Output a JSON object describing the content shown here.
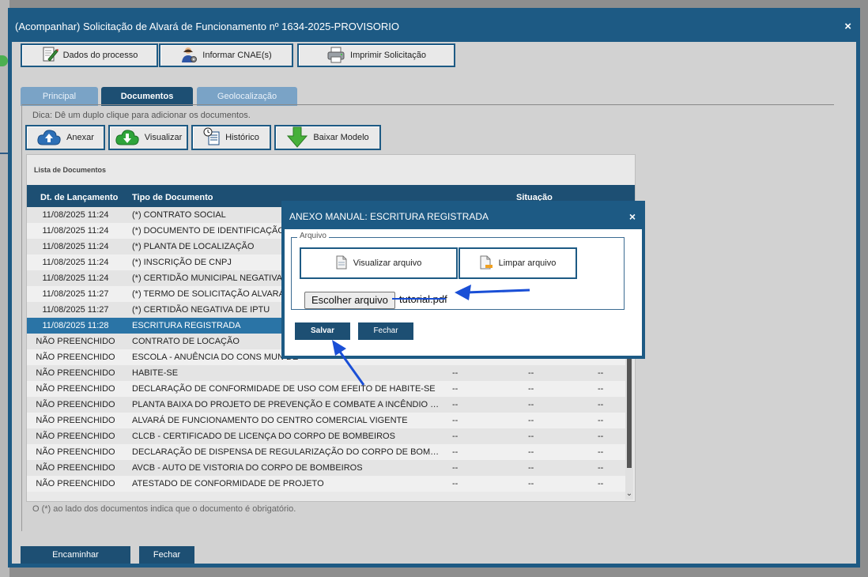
{
  "window": {
    "title": "(Acompanhar) Solicitação de Alvará de Funcionamento nº 1634-2025-PROVISORIO",
    "close": "×"
  },
  "toolbar": {
    "dados": "Dados do processo",
    "cnae": "Informar CNAE(s)",
    "imprimir": "Imprimir Solicitação"
  },
  "tabs": [
    {
      "label": "Principal"
    },
    {
      "label": "Documentos"
    },
    {
      "label": "Geolocalização"
    }
  ],
  "hint": "Dica: Dê um duplo clique para adicionar os documentos.",
  "docToolbar": {
    "anexar": "Anexar",
    "visualizar": "Visualizar",
    "historico": "Histórico",
    "baixar": "Baixar Modelo"
  },
  "list": {
    "title": "Lista de Documentos",
    "headers": {
      "date": "Dt. de Lançamento",
      "type": "Tipo de Documento",
      "status": "Situação"
    },
    "rows": [
      {
        "date": "11/08/2025 11:24",
        "type": "(*) CONTRATO SOCIAL",
        "a": "",
        "b": "",
        "c": ""
      },
      {
        "date": "11/08/2025 11:24",
        "type": "(*) DOCUMENTO DE IDENTIFICAÇÃO DO",
        "a": "",
        "b": "",
        "c": ""
      },
      {
        "date": "11/08/2025 11:24",
        "type": "(*) PLANTA DE LOCALIZAÇÃO",
        "a": "",
        "b": "",
        "c": ""
      },
      {
        "date": "11/08/2025 11:24",
        "type": "(*) INSCRIÇÃO DE CNPJ",
        "a": "",
        "b": "",
        "c": ""
      },
      {
        "date": "11/08/2025 11:24",
        "type": "(*) CERTIDÃO MUNICIPAL NEGATIVA DE",
        "a": "",
        "b": "",
        "c": ""
      },
      {
        "date": "11/08/2025 11:27",
        "type": "(*) TERMO DE SOLICITAÇÃO ALVARÁ DE",
        "a": "",
        "b": "",
        "c": ""
      },
      {
        "date": "11/08/2025 11:27",
        "type": "(*) CERTIDÃO NEGATIVA DE IPTU",
        "a": "",
        "b": "",
        "c": ""
      },
      {
        "date": "11/08/2025 11:28",
        "type": "ESCRITURA REGISTRADA",
        "a": "",
        "b": "",
        "c": ""
      },
      {
        "date": "NÃO PREENCHIDO",
        "type": "CONTRATO DE LOCAÇÃO",
        "a": "",
        "b": "",
        "c": ""
      },
      {
        "date": "NÃO PREENCHIDO",
        "type": "ESCOLA - ANUÊNCIA DO CONS MUN DE",
        "a": "",
        "b": "",
        "c": ""
      },
      {
        "date": "NÃO PREENCHIDO",
        "type": "HABITE-SE",
        "a": "--",
        "b": "--",
        "c": "--"
      },
      {
        "date": "NÃO PREENCHIDO",
        "type": "DECLARAÇÃO DE CONFORMIDADE DE USO COM EFEITO DE HABITE-SE",
        "a": "--",
        "b": "--",
        "c": "--"
      },
      {
        "date": "NÃO PREENCHIDO",
        "type": "PLANTA BAIXA DO PROJETO DE PREVENÇÃO E COMBATE A INCÊNDIO E PÂNICO...",
        "a": "--",
        "b": "--",
        "c": "--"
      },
      {
        "date": "NÃO PREENCHIDO",
        "type": "ALVARÁ DE FUNCIONAMENTO DO CENTRO COMERCIAL VIGENTE",
        "a": "--",
        "b": "--",
        "c": "--"
      },
      {
        "date": "NÃO PREENCHIDO",
        "type": "CLCB - CERTIFICADO DE LICENÇA DO CORPO DE BOMBEIROS",
        "a": "--",
        "b": "--",
        "c": "--"
      },
      {
        "date": "NÃO PREENCHIDO",
        "type": "DECLARAÇÃO DE DISPENSA DE REGULARIZAÇÃO DO CORPO DE BOMBEIROS",
        "a": "--",
        "b": "--",
        "c": "--"
      },
      {
        "date": "NÃO PREENCHIDO",
        "type": "AVCB - AUTO DE VISTORIA DO CORPO DE BOMBEIROS",
        "a": "--",
        "b": "--",
        "c": "--"
      },
      {
        "date": "NÃO PREENCHIDO",
        "type": "ATESTADO DE CONFORMIDADE DE PROJETO",
        "a": "--",
        "b": "--",
        "c": "--"
      }
    ]
  },
  "note": "O (*) ao lado dos documentos indica que o documento é obrigatório.",
  "footer": {
    "encaminhar": "Encaminhar",
    "fechar": "Fechar"
  },
  "modal": {
    "title": "ANEXO MANUAL: ESCRITURA REGISTRADA",
    "close": "×",
    "legend": "Arquivo",
    "visualizar": "Visualizar arquivo",
    "limpar": "Limpar arquivo",
    "choose": "Escolher arquivo",
    "filename": "tutorial.pdf",
    "salvar": "Salvar",
    "fechar": "Fechar"
  },
  "colors": {
    "primary": "#1d5a84",
    "selectedRow": "#2a74a6",
    "annotation": "#1a4fd6"
  }
}
